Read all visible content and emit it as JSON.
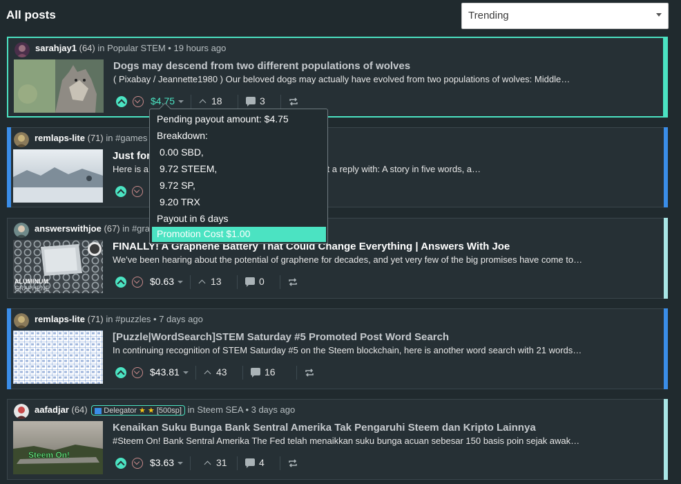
{
  "header": {
    "title": "All posts",
    "sort_selected": "Trending"
  },
  "colors": {
    "accent": "#4be3c2",
    "blue_accent": "#3a8de8",
    "background": "#202a2e",
    "card": "#263035"
  },
  "posts": [
    {
      "author": "sarahjay1",
      "rep": "(64)",
      "community_prefix": "in",
      "community": "Popular STEM",
      "time": "• 19 hours ago",
      "title": "Dogs may descend from two different populations of wolves",
      "summary": "( Pixabay / Jeannette1980 ) Our beloved dogs may actually have evolved from two populations of wolves: Middle…",
      "payout": "$4.75",
      "votes": "18",
      "comments": "3"
    },
    {
      "author": "remlaps-lite",
      "rep": "(71)",
      "community_prefix": "in",
      "community": "#games •",
      "time": "",
      "title": "Just for",
      "summary_start": "Here is a",
      "summary_end": "st a reply with: A story in five words, a…",
      "payout": "",
      "votes": "",
      "comments": ""
    },
    {
      "author": "answerswithjoe",
      "rep": "(67)",
      "community_prefix": "in",
      "community": "#grap",
      "time": "",
      "title": "FINALLY! A Graphene Battery That Could Change Everything | Answers With Joe",
      "summary": "We've been hearing about the potential of graphene for decades, and yet very few of the big promises have come to…",
      "payout": "$0.63",
      "votes": "13",
      "comments": "0",
      "thumb_text_1": "ALUMINUM",
      "thumb_text_2": "GRAPHENE"
    },
    {
      "author": "remlaps-lite",
      "rep": "(71)",
      "community_prefix": "in",
      "community": "#puzzles",
      "time": "• 7 days ago",
      "title": "[Puzzle|WordSearch]STEM Saturday #5 Promoted Post Word Search",
      "summary": "In continuing recognition of STEM Saturday #5 on the Steem blockchain, here is another word search with 21 words…",
      "payout": "$43.81",
      "votes": "43",
      "comments": "16"
    },
    {
      "author": "aafadjar",
      "rep": "(64)",
      "badge_label": "Delegator",
      "badge_stars": "★ ★",
      "badge_sp": "[500sp]",
      "community_prefix": "in",
      "community": "Steem SEA",
      "time": "• 3 days ago",
      "title": "Kenaikan Suku Bunga Bank Sentral Amerika Tak Pengaruhi Steem dan Kripto Lainnya",
      "summary": "#Steem On! Bank Sentral Amerika The Fed telah menaikkan suku bunga acuan sebesar 150 basis poin sejak awak…",
      "payout": "$3.63",
      "votes": "31",
      "comments": "4",
      "thumb_text": "Steem On!"
    }
  ],
  "tooltip": {
    "pending": "Pending payout amount: $4.75",
    "breakdown": "Breakdown:",
    "sbd": "0.00 SBD,",
    "steem": "9.72 STEEM,",
    "sp": "9.72 SP,",
    "trx": "9.20 TRX",
    "payout_in": "Payout in 6 days",
    "promotion": "Promotion Cost $1.00"
  }
}
